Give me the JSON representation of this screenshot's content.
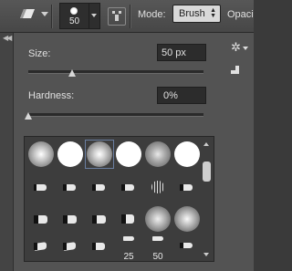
{
  "toolbar": {
    "tool_icon": "eraser-icon",
    "brush_size": "50",
    "brush_panel_icon": "brush-panel-toggle-icon",
    "mode_label": "Mode:",
    "mode_value": "Brush",
    "opacity_label": "Opaci"
  },
  "panel": {
    "size_label": "Size:",
    "size_value": "50 px",
    "size_fraction": 0.24,
    "hardness_label": "Hardness:",
    "hardness_value": "0%",
    "hardness_fraction": 0.0
  },
  "brush_grid": {
    "numbers": [
      "25",
      "50"
    ]
  },
  "colors": {
    "toolbar_bg": "#4e4e4e",
    "panel_bg": "#535353",
    "field_bg": "#2c2c2c",
    "selection_border": "#6a7ea0"
  }
}
